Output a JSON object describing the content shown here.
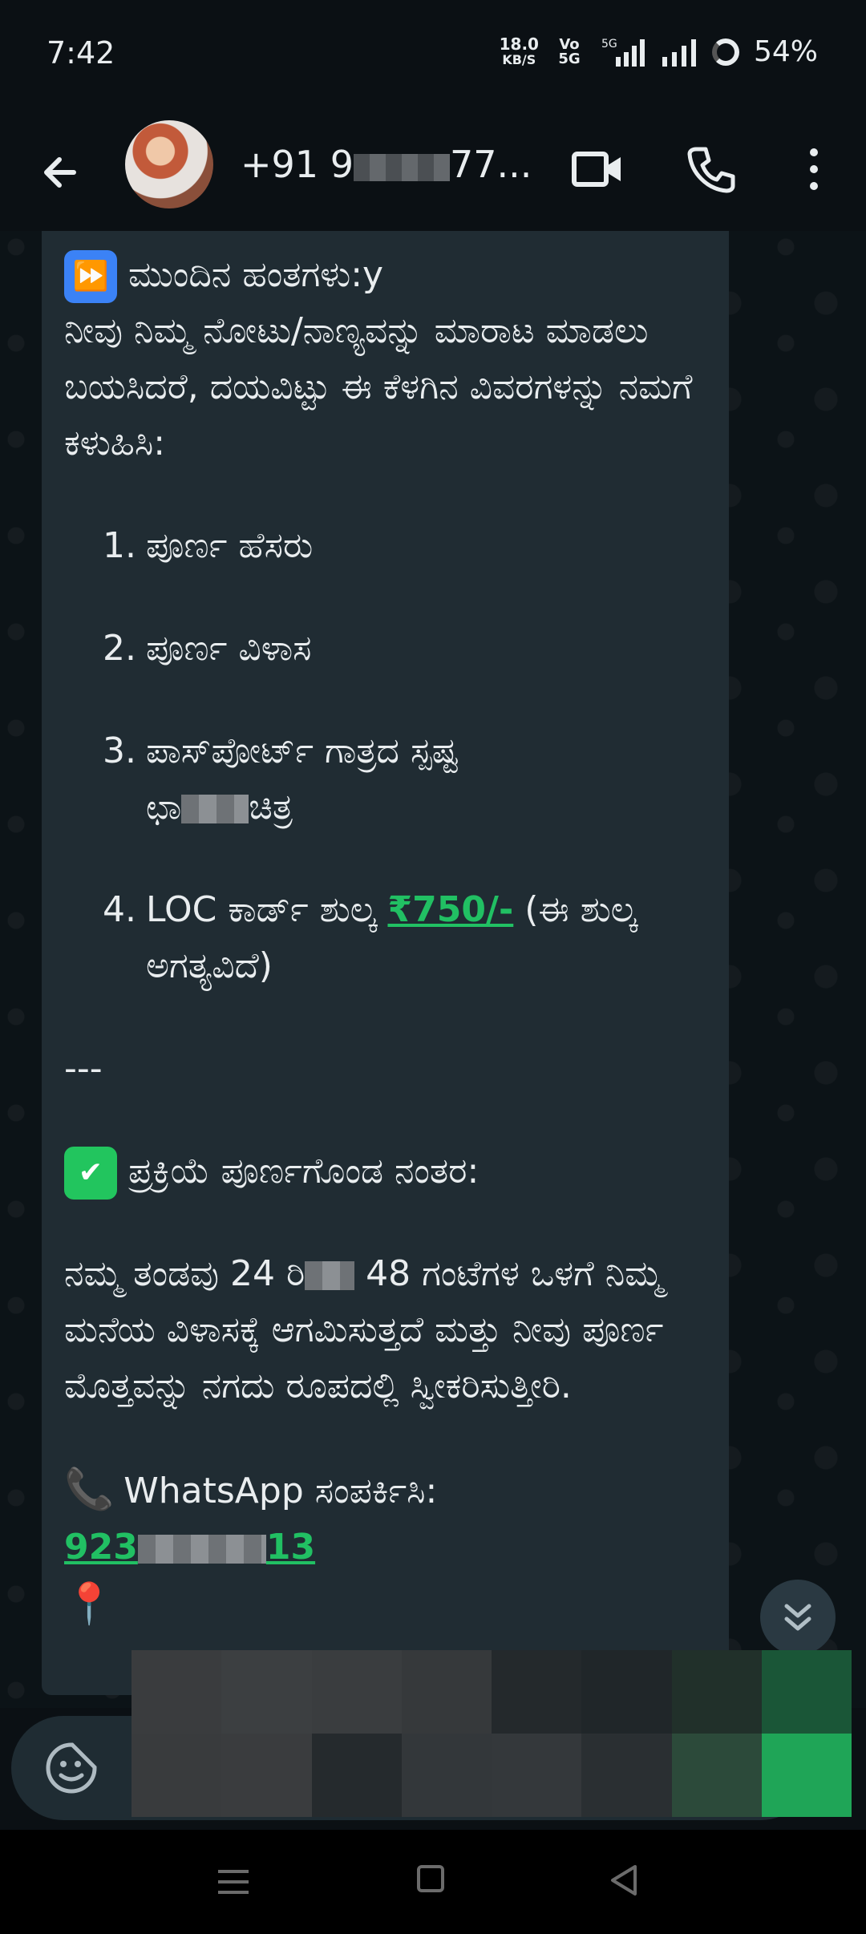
{
  "status_bar": {
    "time": "7:42",
    "net_speed_value": "18.0",
    "net_speed_unit": "KB/S",
    "volte_label": "Vo 5G",
    "network_label": "5G",
    "battery": "54%"
  },
  "header": {
    "contact_prefix": "+91 9",
    "contact_suffix": "77..."
  },
  "message": {
    "next_steps_heading": "ಮುಂದಿನ ಹಂತಗಳು:y",
    "intro": "ನೀವು ನಿಮ್ಮ ನೋಟು/ನಾಣ್ಯವನ್ನು ಮಾರಾಟ ಮಾಡಲು ಬಯಸಿದರೆ, ದಯವಿಟ್ಟು ಈ ಕೆಳಗಿನ ವಿವರಗಳನ್ನು ನಮಗೆ ಕಳುಹಿಸಿ:",
    "items": [
      {
        "num": "1.",
        "text": "ಪೂರ್ಣ ಹೆಸರು"
      },
      {
        "num": "2.",
        "text": "ಪೂರ್ಣ ವಿಳಾಸ"
      },
      {
        "num": "3.",
        "text_a": "ಪಾಸ್‌ಪೋರ್ಟ್ ಗಾತ್ರದ ಸ್ಪಷ್ಟ",
        "text_b_prefix": "ಛಾ",
        "text_b_suffix": "ಚಿತ್ರ"
      },
      {
        "num": "4.",
        "text_prefix": "LOC ಕಾರ್ಡ್ ಶುಲ್ಕ ",
        "fee": "₹750/-",
        "text_suffix": " (ಈ ಶುಲ್ಕ ಅಗತ್ಯವಿದೆ)"
      }
    ],
    "divider": "---",
    "completion_heading": "ಪ್ರಕ್ರಿಯೆ ಪೂರ್ಣಗೊಂಡ ನಂತರ:",
    "completion_prefix": "ನಮ್ಮ ತಂಡವು 24 ರಿ",
    "completion_suffix": " 48 ಗಂಟೆಗಳ ಒಳಗೆ ನಿಮ್ಮ ಮನೆಯ ವಿಳಾಸಕ್ಕೆ ಆಗಮಿಸುತ್ತದೆ ಮತ್ತು ನೀವು ಪೂರ್ಣ ಮೊತ್ತವನ್ನು ನಗದು ರೂಪದಲ್ಲಿ ಸ್ವೀಕರಿಸುತ್ತೀರಿ.",
    "whatsapp_label": "WhatsApp ಸಂಪರ್ಕಿಸಿ:",
    "phone_prefix": "923",
    "phone_suffix": "13"
  },
  "colors": {
    "bubble": "#202c33",
    "accent_green": "#21c063"
  }
}
